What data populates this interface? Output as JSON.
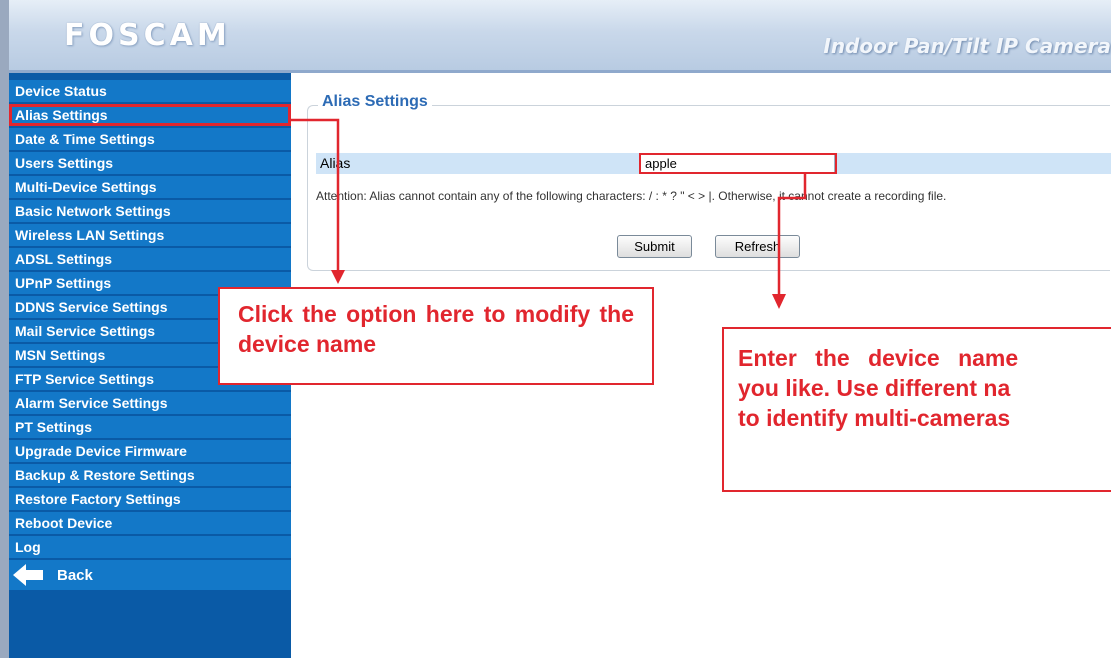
{
  "header": {
    "logo_text": "FOSCAM",
    "product_title": "Indoor Pan/Tilt IP Camera"
  },
  "sidebar": {
    "items": [
      {
        "label": "Device Status"
      },
      {
        "label": "Alias Settings",
        "active": true
      },
      {
        "label": "Date & Time Settings"
      },
      {
        "label": "Users Settings"
      },
      {
        "label": "Multi-Device Settings"
      },
      {
        "label": "Basic Network Settings"
      },
      {
        "label": "Wireless LAN Settings"
      },
      {
        "label": "ADSL Settings"
      },
      {
        "label": "UPnP Settings"
      },
      {
        "label": "DDNS Service Settings"
      },
      {
        "label": "Mail Service Settings"
      },
      {
        "label": "MSN Settings"
      },
      {
        "label": "FTP Service Settings"
      },
      {
        "label": "Alarm Service Settings"
      },
      {
        "label": "PT Settings"
      },
      {
        "label": "Upgrade Device Firmware"
      },
      {
        "label": "Backup & Restore Settings"
      },
      {
        "label": "Restore Factory Settings"
      },
      {
        "label": "Reboot Device"
      },
      {
        "label": "Log"
      }
    ],
    "back_label": "Back"
  },
  "alias_settings": {
    "legend": "Alias Settings",
    "field_label": "Alias",
    "field_value": "apple",
    "attention": "Attention: Alias cannot contain any of the following characters: / : * ? \" < > |. Otherwise, it cannot create a recording file.",
    "submit_label": "Submit",
    "refresh_label": "Refresh"
  },
  "annotations": {
    "callout_sidebar": "Click the option here to modify the device name",
    "callout_alias_lines": [
      "Enter the device name",
      "you like. Use different na",
      "to identify multi-cameras"
    ]
  },
  "colors": {
    "sidebar_bg": "#0a5aa6",
    "menu_item": "#1378c8",
    "annotation_red": "#e1262e",
    "legend_blue": "#2d6bb5",
    "alias_row_bg": "#cfe4f7"
  }
}
